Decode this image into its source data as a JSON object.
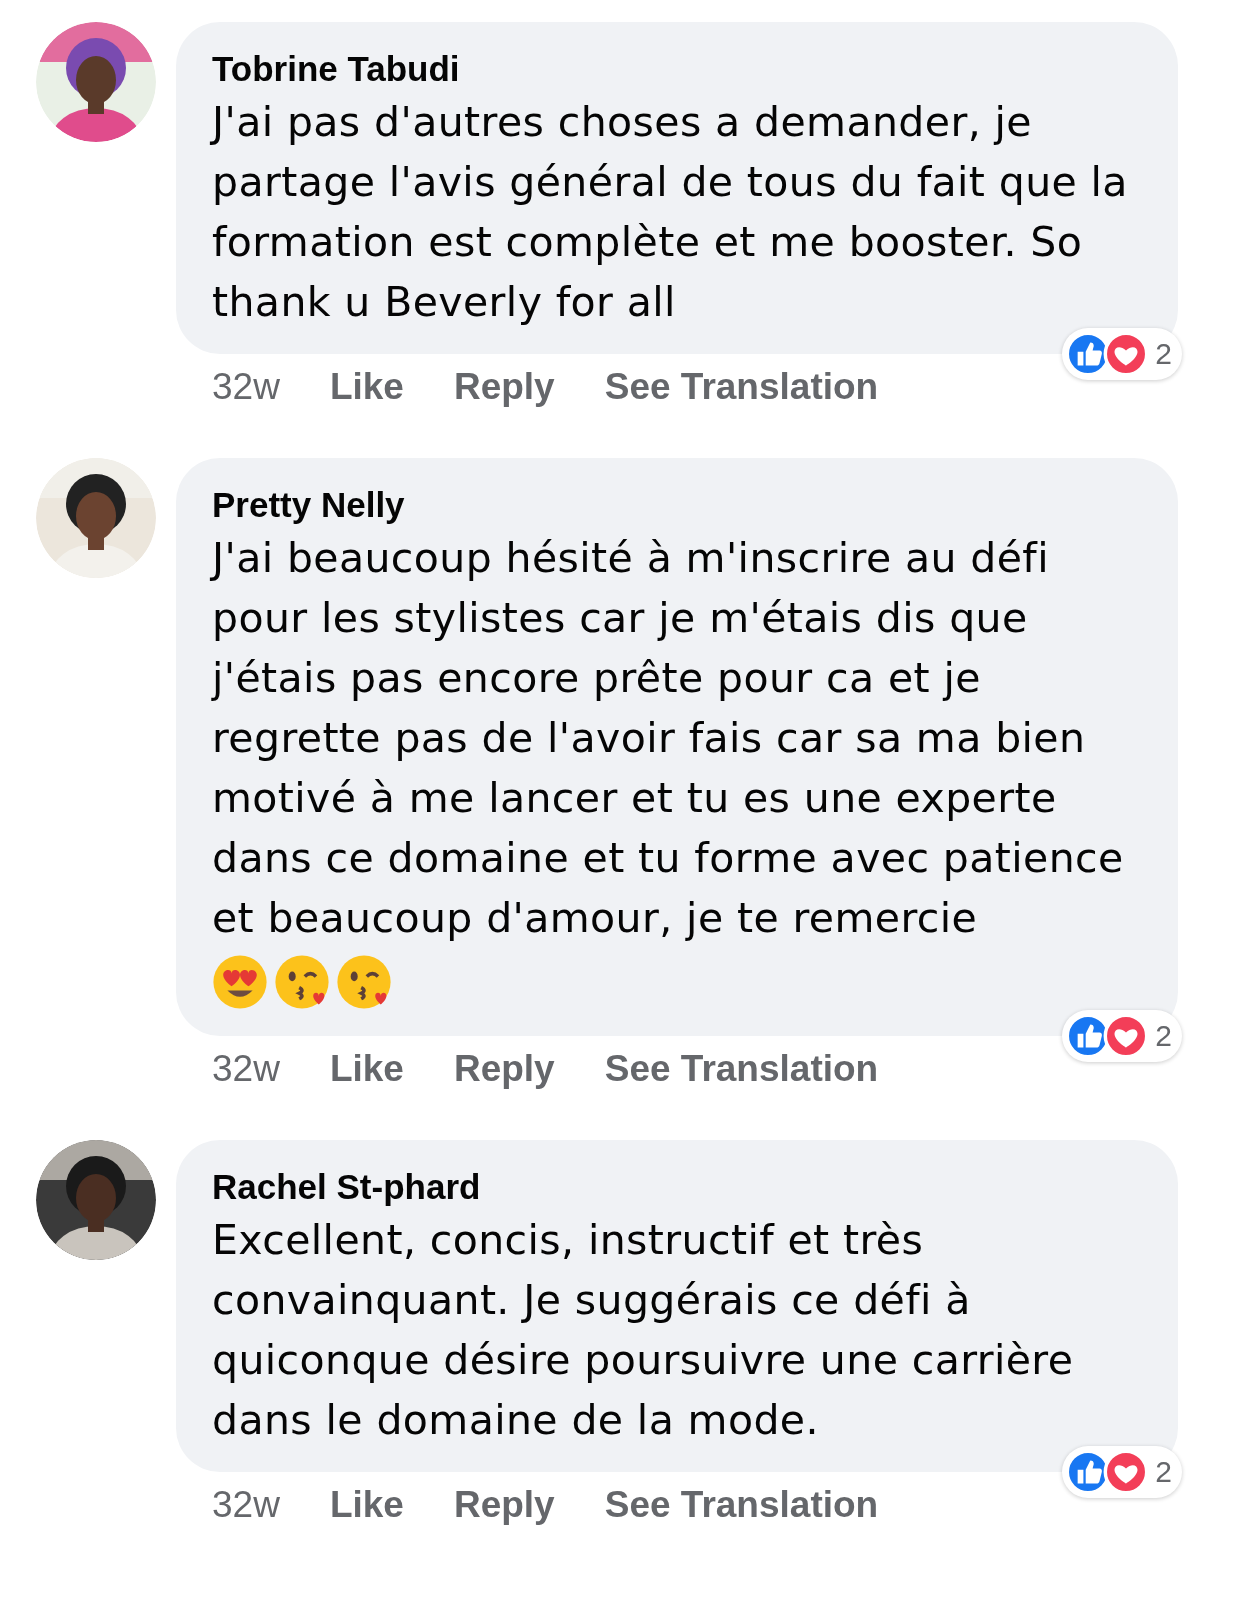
{
  "comments": [
    {
      "author": "Tobrine Tabudi",
      "text": "J'ai pas d'autres choses a demander, je partage l'avis général de tous du fait que la formation est complète et me booster. So thank u Beverly for all",
      "time": "32w",
      "actions": [
        "Like",
        "Reply",
        "See Translation"
      ],
      "reaction_count": "2"
    },
    {
      "author": "Pretty Nelly",
      "text": "J'ai beaucoup hésité à m'inscrire au défi pour les stylistes car je m'étais dis que j'étais pas encore prête pour ca et je regrette pas de l'avoir fais car sa ma bien motivé à me lancer et tu es une experte dans ce domaine et tu forme avec patience et beaucoup d'amour, je te remercie",
      "emojis": [
        {
          "kind": "heart-eyes"
        },
        {
          "kind": "kiss"
        },
        {
          "kind": "kiss"
        }
      ],
      "time": "32w",
      "actions": [
        "Like",
        "Reply",
        "See Translation"
      ],
      "reaction_count": "2"
    },
    {
      "author": "Rachel St-phard",
      "text": "Excellent, concis, instructif et très convainquant. Je suggérais ce défi à quiconque désire poursuivre une carrière dans le domaine de la mode.",
      "time": "32w",
      "actions": [
        "Like",
        "Reply",
        "See Translation"
      ],
      "reaction_count": "2"
    }
  ]
}
